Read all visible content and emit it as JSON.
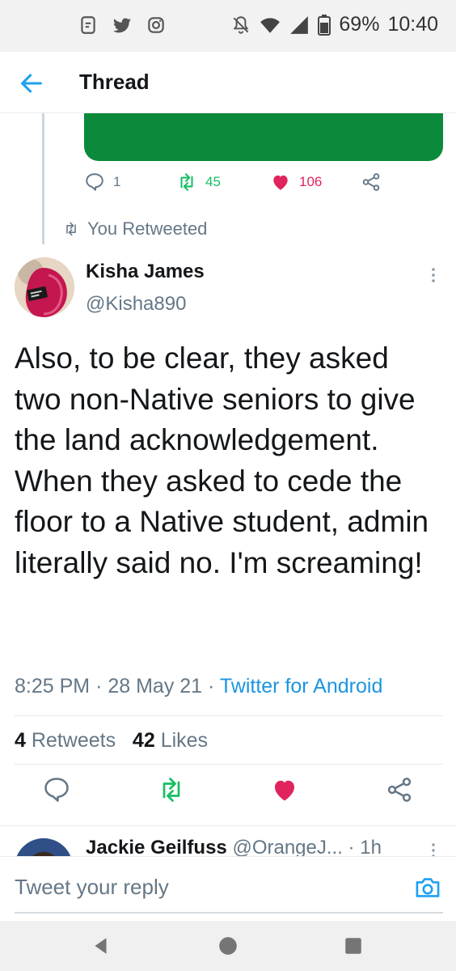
{
  "status_bar": {
    "battery": "69%",
    "time": "10:40",
    "left_icons": [
      "screenshot-icon",
      "twitter-icon",
      "instagram-icon"
    ],
    "right_icons": [
      "mute-icon",
      "wifi-icon",
      "signal-icon",
      "battery-icon"
    ]
  },
  "header": {
    "title": "Thread",
    "back_icon": "arrow-left-icon"
  },
  "previous_tweet": {
    "media_color": "#0a8a3a",
    "reply_count": "1",
    "retweet_count": "45",
    "like_count": "106"
  },
  "retweet_note": "You Retweeted",
  "tweet": {
    "author_name": "Kisha James",
    "author_handle": "@Kisha890",
    "text": "Also, to be clear, they asked two non-Native seniors to give the land acknowledgement. When they asked to cede the floor to a Native student, admin literally said no. I'm screaming!",
    "time": "8:25 PM",
    "date": "28 May 21",
    "source": "Twitter for Android",
    "retweets": "4",
    "retweets_label": "Retweets",
    "likes": "42",
    "likes_label": "Likes",
    "liked": true
  },
  "next_reply": {
    "name": "Jackie Geilfuss",
    "handle": "@OrangeJ...",
    "time": "1h"
  },
  "composer": {
    "placeholder": "Tweet your reply"
  },
  "colors": {
    "accent": "#1da1f2",
    "link": "#1b95e0",
    "retweet": "#17bf63",
    "like": "#e0245e",
    "secondary_text": "#657786"
  }
}
